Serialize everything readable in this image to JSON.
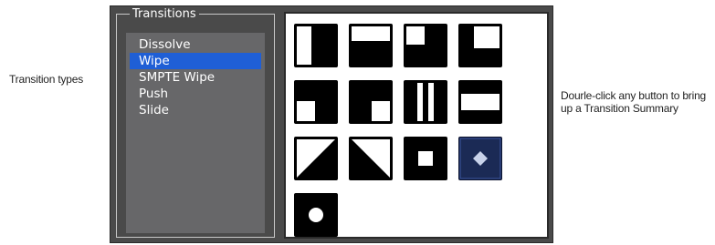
{
  "callouts": {
    "left": "Transition types",
    "right": "Dourle-click any button to bring up a Transition Summary"
  },
  "transitions_group": {
    "title": "Transitions",
    "items": [
      {
        "label": "Dissolve",
        "selected": false
      },
      {
        "label": "Wipe",
        "selected": true
      },
      {
        "label": "SMPTE Wipe",
        "selected": false
      },
      {
        "label": "Push",
        "selected": false
      },
      {
        "label": "Slide",
        "selected": false
      }
    ]
  },
  "wipe_buttons": [
    {
      "icon": "wipe-left-half-icon"
    },
    {
      "icon": "wipe-bottom-half-icon"
    },
    {
      "icon": "wipe-bottom-right-corner-icon"
    },
    {
      "icon": "wipe-top-left-corner-icon"
    },
    {
      "icon": "wipe-inverse-top-left-corner-icon"
    },
    {
      "icon": "wipe-inverse-top-right-corner-icon"
    },
    {
      "icon": "wipe-vertical-barn-door-icon"
    },
    {
      "icon": "wipe-horizontal-barn-door-icon"
    },
    {
      "icon": "wipe-diagonal-bottom-left-icon"
    },
    {
      "icon": "wipe-diagonal-top-left-icon"
    },
    {
      "icon": "wipe-box-icon"
    },
    {
      "icon": "wipe-diamond-icon",
      "selected": true
    },
    {
      "icon": "wipe-circle-icon"
    }
  ],
  "colors": {
    "selection": "#1f5fd6",
    "panel": "#4a4a4a",
    "list": "#676769",
    "selected_button": "#1b2a55"
  }
}
